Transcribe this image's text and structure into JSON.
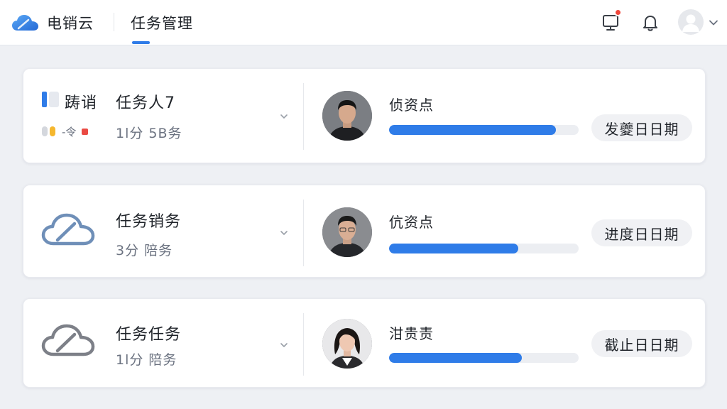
{
  "header": {
    "app_name": "电销云",
    "active_tab": "任务管理",
    "notifications_badge": true,
    "icons": [
      "cloud-logo-icon",
      "monitor-icon",
      "bell-icon",
      "user-avatar-icon",
      "chevron-down-icon"
    ]
  },
  "colors": {
    "accent": "#2f7ce8",
    "badge": "#f0473c",
    "card_bg": "#ffffff",
    "page_bg": "#eef0f4"
  },
  "tasks": [
    {
      "prefix": "踌诮",
      "title": "任务人7",
      "subtitle": "1l分 5B务",
      "mini_label": "-令",
      "person_name": "侦资点",
      "progress": 0.88,
      "date_label": "发夔日日期"
    },
    {
      "title": "任务销务",
      "subtitle": "3分 陪务",
      "person_name": "伉资点",
      "progress": 0.68,
      "date_label": "进度日日期"
    },
    {
      "title": "任务任务",
      "subtitle": "1l分 陪务",
      "person_name": "泔贵责",
      "progress": 0.7,
      "date_label": "截止日日期"
    }
  ]
}
